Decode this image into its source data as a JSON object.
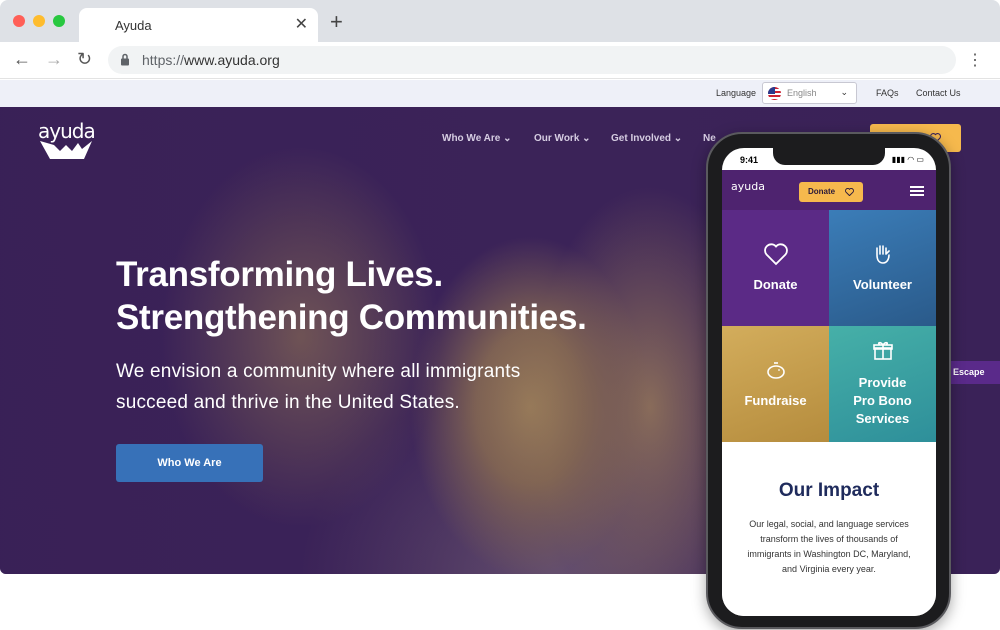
{
  "browser": {
    "tab_title": "Ayuda",
    "new_tab": "+",
    "url_protocol": "https://",
    "url_host": "www.ayuda.org",
    "icons": [
      "back-icon",
      "forward-icon",
      "reload-icon",
      "lock-icon",
      "menu-icon",
      "close-icon"
    ]
  },
  "utility_bar": {
    "language_label": "Language",
    "language_value": "English",
    "faqs": "FAQs",
    "contact": "Contact Us"
  },
  "site": {
    "logo": "ayuda",
    "nav": [
      {
        "label": "Who We Are"
      },
      {
        "label": "Our Work"
      },
      {
        "label": "Get Involved"
      },
      {
        "label": "Ne"
      }
    ],
    "hero_title_line1": "Transforming Lives.",
    "hero_title_line2": "Strengthening Communities.",
    "hero_sub_line1": "We envision a community where all immigrants",
    "hero_sub_line2": "succeed and thrive in the United States.",
    "hero_button": "Who We Are",
    "escape": "Escape"
  },
  "mobile": {
    "time": "9:41",
    "logo": "ayuda",
    "donate": "Donate",
    "tiles": [
      {
        "label": "Donate",
        "icon": "heart-icon",
        "color": "#5b2a86"
      },
      {
        "label": "Volunteer",
        "icon": "hand-icon",
        "color": "#2f6fa8"
      },
      {
        "label": "Fundraise",
        "icon": "piggy-bank-icon",
        "color": "#c9a14e"
      },
      {
        "label_lines": [
          "Provide",
          "Pro Bono",
          "Services"
        ],
        "icon": "gift-icon",
        "color": "#3aa4a6"
      }
    ],
    "impact_title": "Our Impact",
    "impact_lines": [
      "Our legal, social, and language services",
      "transform the lives of thousands of",
      "immigrants in Washington DC, Maryland,",
      "and Virginia every year."
    ]
  },
  "colors": {
    "hero_purple": "#3c2459",
    "accent_gold": "#f6b94d",
    "button_blue": "#3771b8",
    "impact_navy": "#1f2b5c"
  }
}
